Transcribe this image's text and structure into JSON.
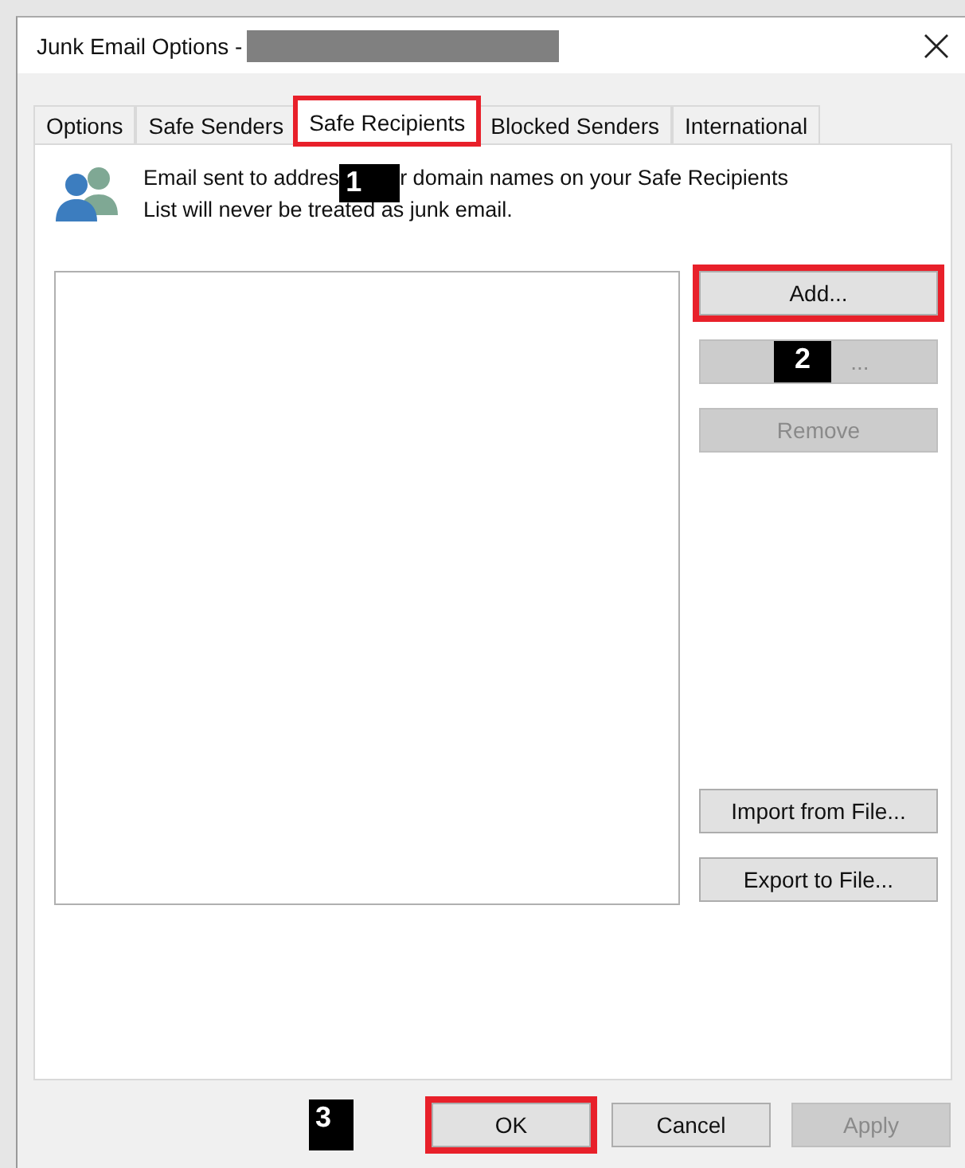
{
  "window": {
    "title": "Junk Email Options -",
    "title_redacted": true
  },
  "tabs": [
    {
      "label": "Options",
      "selected": false,
      "highlighted": false
    },
    {
      "label": "Safe Senders",
      "selected": false,
      "highlighted": false
    },
    {
      "label": "Safe Recipients",
      "selected": true,
      "highlighted": true
    },
    {
      "label": "Blocked Senders",
      "selected": false,
      "highlighted": false
    },
    {
      "label": "International",
      "selected": false,
      "highlighted": false
    }
  ],
  "description": {
    "line_1_start": "Email sent to addres",
    "line_1_end": "r domain names on your Safe Recipients",
    "line_2": "List will never be treated as junk email."
  },
  "side_buttons_top": [
    {
      "label": "Add...",
      "disabled": false,
      "highlighted": true
    },
    {
      "label": "...",
      "disabled": true,
      "highlighted": false
    },
    {
      "label": "Remove",
      "disabled": true,
      "highlighted": false
    }
  ],
  "side_buttons_bottom": [
    {
      "label": "Import from File...",
      "disabled": false,
      "highlighted": false
    },
    {
      "label": "Export to File...",
      "disabled": false,
      "highlighted": false
    }
  ],
  "footer_buttons": [
    {
      "label": "OK",
      "disabled": false,
      "highlighted": true
    },
    {
      "label": "Cancel",
      "disabled": false,
      "highlighted": false
    },
    {
      "label": "Apply",
      "disabled": true,
      "highlighted": false
    }
  ],
  "step_badges": [
    "1",
    "2",
    "3"
  ]
}
